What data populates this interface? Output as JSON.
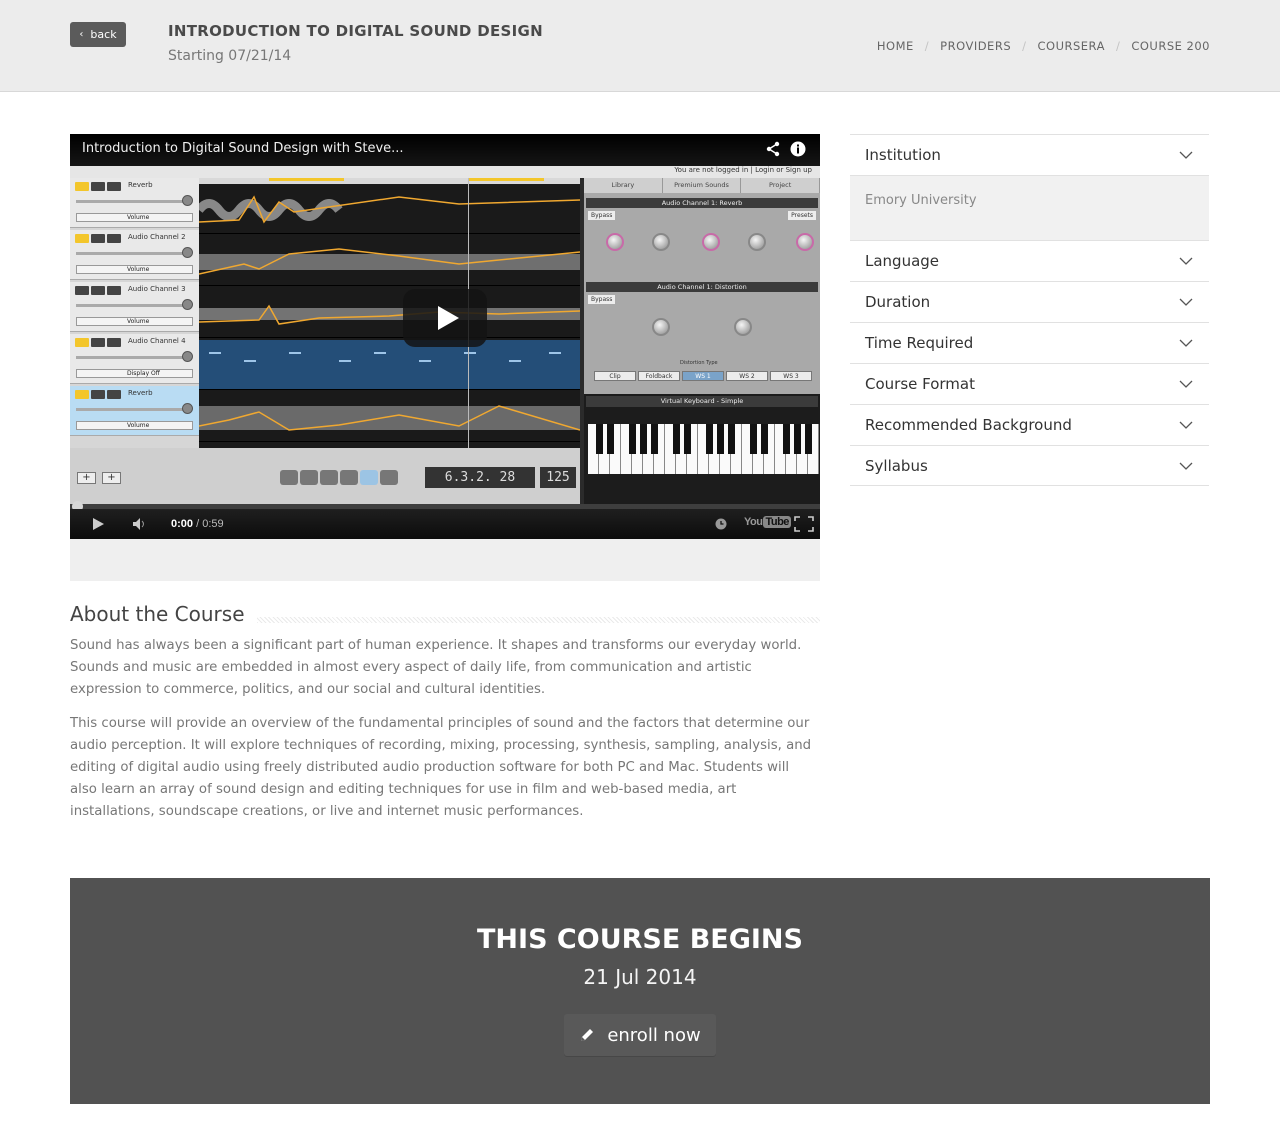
{
  "header": {
    "back_label": "back",
    "title": "INTRODUCTION TO DIGITAL SOUND DESIGN",
    "start_text": "Starting 07/21/14",
    "breadcrumbs": [
      "HOME",
      "PROVIDERS",
      "COURSERA",
      "COURSE 200"
    ]
  },
  "video": {
    "title": "Introduction to Digital Sound Design with Steve...",
    "login_notice": "You are not logged in | Login or Sign up",
    "current_time": "0:00",
    "duration": "/ 0:59",
    "logo_left": "You",
    "logo_right": "Tube",
    "lcd_position": "6.3.2. 28",
    "lcd_tempo": "125",
    "tracks": [
      {
        "name": "Reverb",
        "auto": "Volume"
      },
      {
        "name": "Audio Channel 2",
        "auto": "Volume"
      },
      {
        "name": "Audio Channel 3",
        "auto": "Volume"
      },
      {
        "name": "Audio Channel 4",
        "auto": "Display Off"
      },
      {
        "name": "Reverb",
        "auto": "Volume"
      }
    ],
    "fx_tabs": [
      "Library",
      "Premium Sounds",
      "Project"
    ],
    "fx_headers": [
      "Audio Channel 1: Reverb",
      "Audio Channel 1: Distortion",
      "Virtual Keyboard - Simple"
    ],
    "fx_tags": [
      "Bypass",
      "Presets",
      "Bypass"
    ],
    "distortion_types": [
      "Clip",
      "Foldback",
      "WS 1",
      "WS 2",
      "WS 3"
    ],
    "distortion_type_label": "Distortion Type"
  },
  "sidebar": {
    "items": [
      {
        "label": "Institution",
        "value": "Emory University",
        "expanded": true
      },
      {
        "label": "Language"
      },
      {
        "label": "Duration"
      },
      {
        "label": "Time Required"
      },
      {
        "label": "Course Format"
      },
      {
        "label": "Recommended Background"
      },
      {
        "label": "Syllabus"
      }
    ]
  },
  "about": {
    "title": "About the Course",
    "paragraphs": [
      "Sound has always been a significant part of human experience. It shapes and transforms our everyday world. Sounds and music are embedded in almost every aspect of daily life, from communication and artistic expression to commerce, politics, and our social and cultural identities.",
      "This course will provide an overview of the fundamental principles of sound and the factors that determine our audio perception. It will explore techniques of recording, mixing, processing, synthesis, sampling, analysis, and editing of digital audio using freely distributed audio production software for both PC and Mac. Students will also learn an array of sound design and editing techniques for use in film and web-based media, art installations, soundscape creations, or live and internet music performances."
    ]
  },
  "begins": {
    "title": "THIS COURSE BEGINS",
    "date": "21 Jul 2014",
    "enroll_label": "enroll now"
  },
  "colors": {
    "header_bg": "#ececec",
    "panel_bg": "#525252",
    "waveform_accent": "#f0a830"
  }
}
